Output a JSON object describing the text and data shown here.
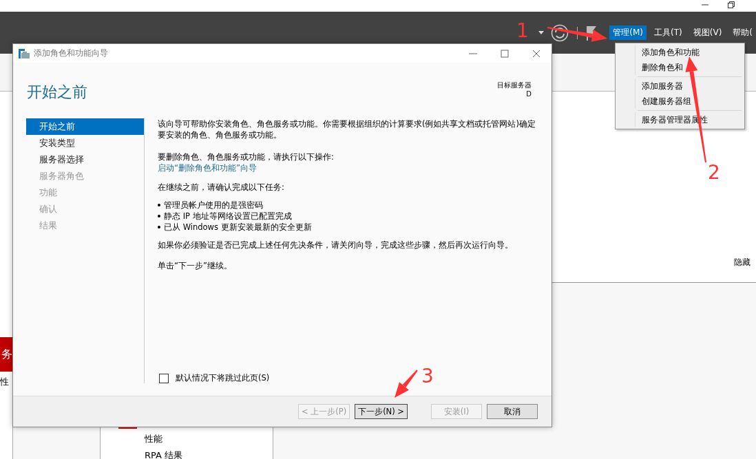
{
  "background_window": {
    "menus": [
      {
        "label": "管理(M)",
        "selected": true
      },
      {
        "label": "工具(T)",
        "selected": false
      },
      {
        "label": "视图(V)",
        "selected": false
      },
      {
        "label": "帮助(",
        "selected": false
      }
    ],
    "left_fragments": [
      {
        "text": "务",
        "kind": "tile"
      },
      {
        "text": "性",
        "kind": "plain"
      }
    ],
    "hide_link": "隐藏",
    "bottom_panel": [
      "性能",
      "RPA 结果"
    ]
  },
  "manage_menu": {
    "groups": [
      [
        "添加角色和功能",
        "删除角色和"
      ],
      [
        "添加服务器",
        "创建服务器组"
      ],
      [
        "服务器管理器属性"
      ]
    ]
  },
  "wizard": {
    "title": "添加角色和功能向导",
    "heading": "开始之前",
    "target_label": "目标服务器",
    "target_value": "D",
    "steps": [
      {
        "label": "开始之前",
        "selected": true,
        "disabled": false
      },
      {
        "label": "安装类型",
        "selected": false,
        "disabled": false
      },
      {
        "label": "服务器选择",
        "selected": false,
        "disabled": false
      },
      {
        "label": "服务器角色",
        "selected": false,
        "disabled": true
      },
      {
        "label": "功能",
        "selected": false,
        "disabled": true
      },
      {
        "label": "确认",
        "selected": false,
        "disabled": true
      },
      {
        "label": "结果",
        "selected": false,
        "disabled": true
      }
    ],
    "intro": "该向导可帮助你安装角色、角色服务或功能。你需要根据组织的计算要求(例如共享文档或托管网站)确定要安装的角色、角色服务或功能。",
    "remove_prompt": "要删除角色、角色服务或功能，请执行以下操作:",
    "remove_link": "启动“删除角色和功能”向导",
    "before_prompt": "在继续之前，请确认完成以下任务:",
    "tasks": [
      "管理员帐户使用的是强密码",
      "静态 IP 地址等网络设置已配置完成",
      "已从 Windows 更新安装最新的安全更新"
    ],
    "verify_note": "如果你必须验证是否已完成上述任何先决条件，请关闭向导，完成这些步骤，然后再次运行向导。",
    "continue_note": "单击“下一步”继续。",
    "skip_checkbox": {
      "label": "默认情况下将跳过此页(S)",
      "checked": false
    },
    "buttons": [
      {
        "label": "< 上一步(P)",
        "disabled": true,
        "default": false
      },
      {
        "label": "下一步(N) >",
        "disabled": false,
        "default": true
      },
      {
        "label": "安装(I)",
        "disabled": true,
        "default": false
      },
      {
        "label": "取消",
        "disabled": false,
        "default": false
      }
    ]
  },
  "annotations": [
    "1",
    "2",
    "3"
  ]
}
